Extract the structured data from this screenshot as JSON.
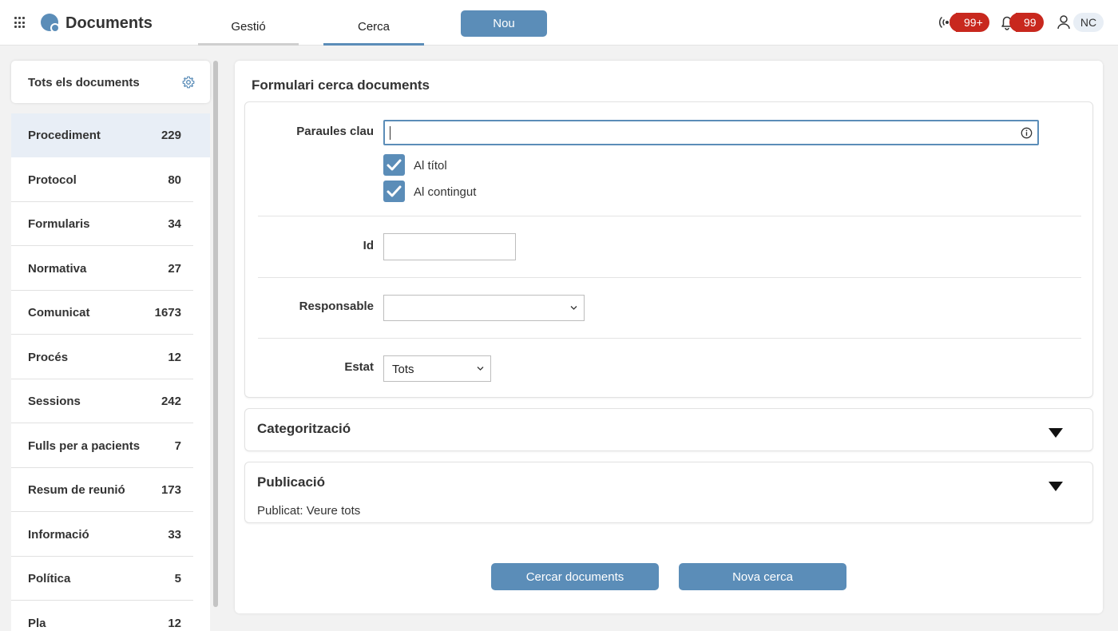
{
  "header": {
    "app_title": "Documents",
    "tabs": [
      {
        "label": "Gestió"
      },
      {
        "label": "Cerca"
      }
    ],
    "new_button": "Nou",
    "broadcast_badge": "99+",
    "notifications_badge": "99",
    "user_initials": "NC",
    "accent_color": "#5b8db8",
    "badge_color": "#c8281e"
  },
  "sidebar": {
    "title": "Tots els documents",
    "items": [
      {
        "label": "Procediment",
        "count": "229"
      },
      {
        "label": "Protocol",
        "count": "80"
      },
      {
        "label": "Formularis",
        "count": "34"
      },
      {
        "label": "Normativa",
        "count": "27"
      },
      {
        "label": "Comunicat",
        "count": "1673"
      },
      {
        "label": "Procés",
        "count": "12"
      },
      {
        "label": "Sessions",
        "count": "242"
      },
      {
        "label": "Fulls per a pacients",
        "count": "7"
      },
      {
        "label": "Resum de reunió",
        "count": "173"
      },
      {
        "label": "Informació",
        "count": "33"
      },
      {
        "label": "Política",
        "count": "5"
      },
      {
        "label": "Pla",
        "count": "12"
      }
    ]
  },
  "form": {
    "title": "Formulari cerca documents",
    "keywords_label": "Paraules clau",
    "keywords_value": "",
    "in_title_label": "Al títol",
    "in_content_label": "Al contingut",
    "id_label": "Id",
    "id_value": "",
    "responsible_label": "Responsable",
    "responsible_value": "",
    "status_label": "Estat",
    "status_value": "Tots"
  },
  "categorization": {
    "title": "Categorització"
  },
  "publication": {
    "title": "Publicació",
    "text": "Publicat: Veure tots"
  },
  "actions": {
    "search_button": "Cercar documents",
    "reset_button": "Nova cerca"
  }
}
